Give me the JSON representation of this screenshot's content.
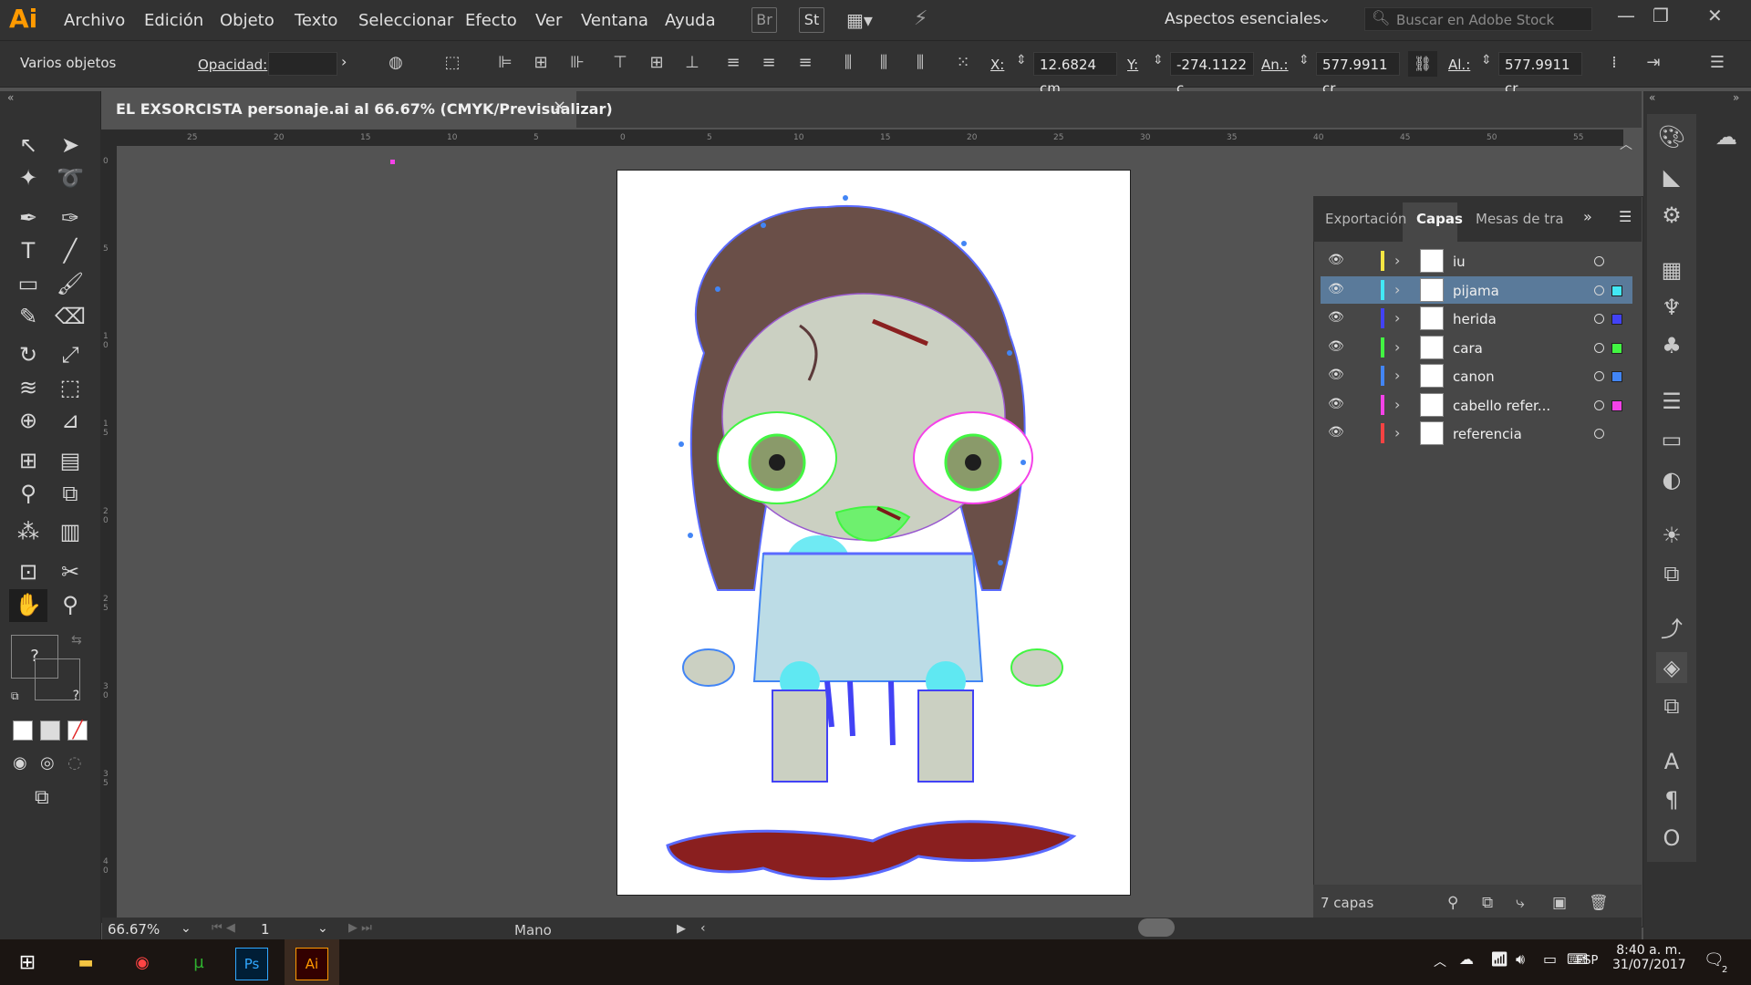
{
  "app": {
    "logo": "Ai",
    "menu": [
      "Archivo",
      "Edición",
      "Objeto",
      "Texto",
      "Seleccionar",
      "Efecto",
      "Ver",
      "Ventana",
      "Ayuda"
    ],
    "menubar_icons": [
      "Br",
      "St"
    ],
    "workspace": "Aspectos esenciales",
    "stock_search_placeholder": "Buscar en Adobe Stock"
  },
  "control_bar": {
    "selection_label": "Varios objetos",
    "opacity_label": "Opacidad:",
    "opacity_value": "",
    "x_label": "X:",
    "x_value": "12.6824 cm",
    "y_label": "Y:",
    "y_value": "-274.1122 c",
    "w_label": "An.:",
    "w_value": "577.9911 cr",
    "h_label": "Al.:",
    "h_value": "577.9911 cr"
  },
  "document_tab": {
    "title": "EL EXSORCISTA personaje.ai al 66.67% (CMYK/Previsualizar)",
    "close": "×"
  },
  "rulers": {
    "top_ticks": [
      "25",
      "20",
      "15",
      "10",
      "5",
      "0",
      "5",
      "10",
      "15",
      "20",
      "25",
      "30",
      "35",
      "40",
      "45",
      "50",
      "55"
    ],
    "left_ticks": [
      "0",
      "5",
      "1 0",
      "1 5",
      "2 0",
      "2 5",
      "3 0",
      "3 5",
      "4 0"
    ]
  },
  "layers_panel": {
    "tabs": [
      "Exportación",
      "Capas",
      "Mesas de tra"
    ],
    "active_tab": "Capas",
    "layers": [
      {
        "name": "iu",
        "color": "#f5e642",
        "square": "",
        "selected": false
      },
      {
        "name": "pijama",
        "color": "#42e8f5",
        "square": "#42e8f5",
        "selected": true
      },
      {
        "name": "herida",
        "color": "#4242f5",
        "square": "#4242f5",
        "selected": false
      },
      {
        "name": "cara",
        "color": "#42f542",
        "square": "#42f542",
        "selected": false
      },
      {
        "name": "canon",
        "color": "#4285f5",
        "square": "#4285f5",
        "selected": false
      },
      {
        "name": "cabello refer...",
        "color": "#f542e8",
        "square": "#f542e8",
        "selected": false
      },
      {
        "name": "referencia",
        "color": "#f54242",
        "square": "",
        "selected": false
      }
    ],
    "count": "7 capas"
  },
  "status_bar": {
    "zoom": "66.67%",
    "page": "1",
    "tool": "Mano"
  },
  "taskbar": {
    "language": "ESP",
    "time": "8:40 a. m.",
    "date": "31/07/2017",
    "notifications": "2"
  }
}
